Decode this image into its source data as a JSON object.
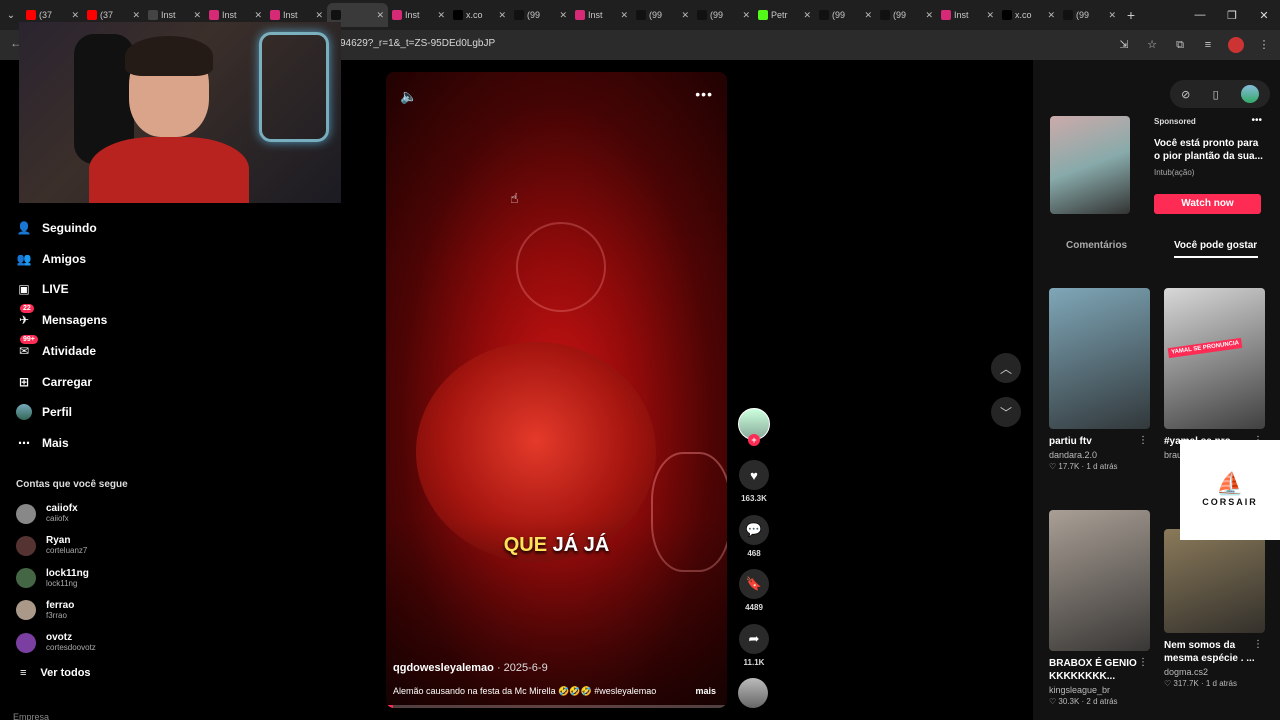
{
  "browser": {
    "tabs": [
      {
        "label": "(37",
        "fav": "youtube-icon",
        "color": "#ff0000"
      },
      {
        "label": "(37",
        "fav": "youtube-icon",
        "color": "#ff0000"
      },
      {
        "label": "Inst",
        "fav": "generic-icon",
        "color": "#444444"
      },
      {
        "label": "Inst",
        "fav": "instagram-icon",
        "color": "#d62976"
      },
      {
        "label": "Inst",
        "fav": "instagram-icon",
        "color": "#d62976"
      },
      {
        "label": "",
        "fav": "tiktok-icon",
        "color": "#111111",
        "active": true
      },
      {
        "label": "Inst",
        "fav": "instagram-icon",
        "color": "#d62976"
      },
      {
        "label": "x.co",
        "fav": "x-icon",
        "color": "#000000"
      },
      {
        "label": "(99",
        "fav": "tiktok-icon",
        "color": "#111111"
      },
      {
        "label": "Inst",
        "fav": "instagram-icon",
        "color": "#d62976"
      },
      {
        "label": "(99",
        "fav": "tiktok-icon",
        "color": "#111111"
      },
      {
        "label": "(99",
        "fav": "tiktok-icon",
        "color": "#111111"
      },
      {
        "label": "Petr",
        "fav": "kick-icon",
        "color": "#53fc18"
      },
      {
        "label": "(99",
        "fav": "tiktok-icon",
        "color": "#111111"
      },
      {
        "label": "(99",
        "fav": "tiktok-icon",
        "color": "#111111"
      },
      {
        "label": "Inst",
        "fav": "instagram-icon",
        "color": "#d62976"
      },
      {
        "label": "x.co",
        "fav": "x-icon",
        "color": "#000000"
      },
      {
        "label": "(99",
        "fav": "tiktok-icon",
        "color": "#111111"
      }
    ],
    "url": "94629?_r=1&_t=ZS-95DEd0LgbJP"
  },
  "sidebar": {
    "nav": [
      {
        "label": "Seguindo",
        "icon": "following-icon",
        "badge": ""
      },
      {
        "label": "Amigos",
        "icon": "friends-icon",
        "badge": ""
      },
      {
        "label": "LIVE",
        "icon": "live-icon",
        "badge": ""
      },
      {
        "label": "Mensagens",
        "icon": "messages-icon",
        "badge": "22"
      },
      {
        "label": "Atividade",
        "icon": "activity-icon",
        "badge": "99+"
      },
      {
        "label": "Carregar",
        "icon": "upload-icon",
        "badge": ""
      },
      {
        "label": "Perfil",
        "icon": "profile-avatar",
        "badge": ""
      },
      {
        "label": "Mais",
        "icon": "more-icon",
        "badge": ""
      }
    ],
    "following_title": "Contas que você segue",
    "accounts": [
      {
        "name": "caiiofx",
        "handle": "caiiofx",
        "color": "#888888"
      },
      {
        "name": "Ryan",
        "handle": "corteluanz7",
        "color": "#553333"
      },
      {
        "name": "lock11ng",
        "handle": "lock11ng",
        "color": "#446644"
      },
      {
        "name": "ferrao",
        "handle": "f3rrao",
        "color": "#aa9988"
      },
      {
        "name": "ovotz",
        "handle": "cortesdoovotz",
        "color": "#7a3fa0"
      }
    ],
    "see_all": "Ver todos",
    "footer": "Empresa"
  },
  "video": {
    "caption_yellow": "QUE",
    "caption_white": "JÁ JÁ",
    "author": "qgdowesleyalemao",
    "date": "2025-6-9",
    "description": "Alemão causando na festa da Mc Mirella 🤣🤣🤣 #wesleyalemao",
    "more_label": "mais",
    "progress": 0.02
  },
  "actions": {
    "likes": "163.3K",
    "comments": "468",
    "saves": "4489",
    "shares": "11.1K"
  },
  "panel": {
    "ad": {
      "sponsored": "Sponsored",
      "title": "Você está pronto para o pior plantão da sua...",
      "brand": "Intub(ação)",
      "cta": "Watch now"
    },
    "tabs": {
      "comments": "Comentários",
      "you_may_like": "Você pode gostar"
    },
    "cards": [
      {
        "title": "partiu ftv",
        "user": "dandara.2.0",
        "likes": "17.7K",
        "age": "1 d atrás",
        "bg": "#7fa7b8"
      },
      {
        "title": "#yamal se pro...",
        "user": "brau...",
        "likes": "",
        "age": "",
        "bg": "#d8d8d8",
        "tag": "YAMAL SE PRONUNCIA"
      },
      {
        "title": "BRABOX É GENIO KKKKKKKK...",
        "user": "kingsleague_br",
        "likes": "30.3K",
        "age": "2 d atrás",
        "bg": "#a99f95"
      },
      {
        "title": "Nem somos da mesma espécie . ...",
        "user": "dogma.cs2",
        "likes": "317.7K",
        "age": "1 d atrás",
        "bg": "#8a7a5a"
      }
    ],
    "sponsor_logo": "CORSAIR"
  },
  "colors": {
    "accent": "#fe2c55",
    "caption_yellow": "#ffe15a"
  }
}
